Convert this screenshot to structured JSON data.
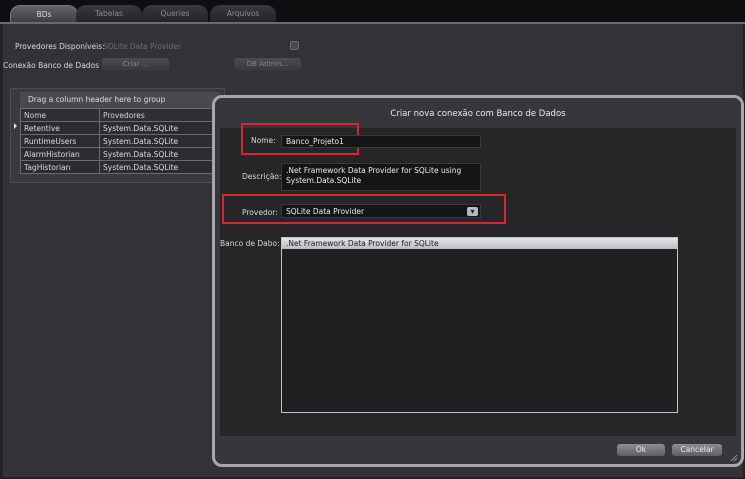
{
  "tabs": [
    {
      "label": "BDs",
      "active": true
    },
    {
      "label": "Tabelas",
      "active": false
    },
    {
      "label": "Queries",
      "active": false
    },
    {
      "label": "Arquivos",
      "active": false
    }
  ],
  "panel": {
    "providers_label": "Provedores Disponíveis:",
    "providers_value": "SQLite Data Provider",
    "connection_label": "Conexão Banco de Dados",
    "create_button": "Criar ...",
    "admin_button": "DB Admin..."
  },
  "grid": {
    "group_hint": "Drag a column header here to group",
    "columns": [
      "Nome",
      "Provedores"
    ],
    "rows": [
      [
        "Retentive",
        "System.Data.SQLite"
      ],
      [
        "RuntimeUsers",
        "System.Data.SQLite"
      ],
      [
        "AlarmHistorian",
        "System.Data.SQLite"
      ],
      [
        "TagHistorian",
        "System.Data.SQLite"
      ]
    ]
  },
  "dialog": {
    "title": "Criar nova conexão com Banco de Dados",
    "name_label": "Nome:",
    "name_value": "Banco_Projeto1",
    "desc_label": "Descrição:",
    "desc_line1": ".Net Framework Data Provider for SQLite using",
    "desc_line2": "System.Data.SQLite",
    "provider_label": "Provedor:",
    "provider_value": "SQLite Data Provider",
    "db_label": "Banco de Dabo:",
    "db_list": [
      ".Net Framework Data Provider for SQLite"
    ],
    "ok_button": "Ok",
    "cancel_button": "Cancelar"
  },
  "colors": {
    "highlight": "#d8262e",
    "background": "#333337",
    "dialog_border": "#a8a8ac"
  },
  "icons": {
    "row_selector": "triangle-right-icon",
    "combo": "chevron-down-icon",
    "resize": "resize-grip-icon"
  }
}
